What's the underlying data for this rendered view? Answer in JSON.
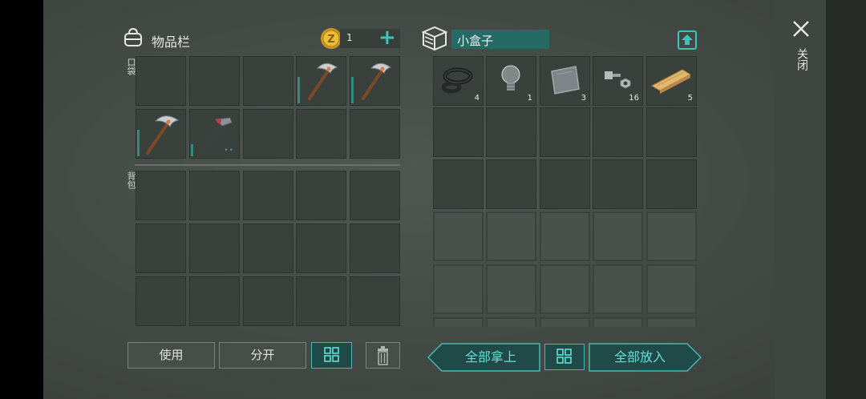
{
  "inventory": {
    "title": "物品栏",
    "coins": "1",
    "add_symbol": "+",
    "pocket_label": "口袋",
    "backpack_label": "背包",
    "pocket_items": [
      {
        "slot": 3,
        "icon": "pickaxe-icon",
        "durability": 0.55
      },
      {
        "slot": 4,
        "icon": "pickaxe-icon",
        "durability": 0.55
      },
      {
        "slot": 5,
        "icon": "pickaxe-icon",
        "durability": 0.55
      },
      {
        "slot": 6,
        "icon": "hammer-icon",
        "durability": 0.25,
        "dots": "••"
      }
    ]
  },
  "container": {
    "name": "小盒子",
    "items": [
      {
        "icon": "rubber-rings-icon",
        "count": "4"
      },
      {
        "icon": "lightbulb-icon",
        "count": "1"
      },
      {
        "icon": "metal-plate-icon",
        "count": "3"
      },
      {
        "icon": "nuts-bolts-icon",
        "count": "16"
      },
      {
        "icon": "wooden-plank-icon",
        "count": "5"
      }
    ]
  },
  "buttons": {
    "use": "使用",
    "split": "分开",
    "take_all": "全部拿上",
    "put_all": "全部放入"
  },
  "close_label": "关闭",
  "colors": {
    "accent": "#46b8b2",
    "accent_text": "#66ddd6",
    "durability": "#2e8c88"
  }
}
